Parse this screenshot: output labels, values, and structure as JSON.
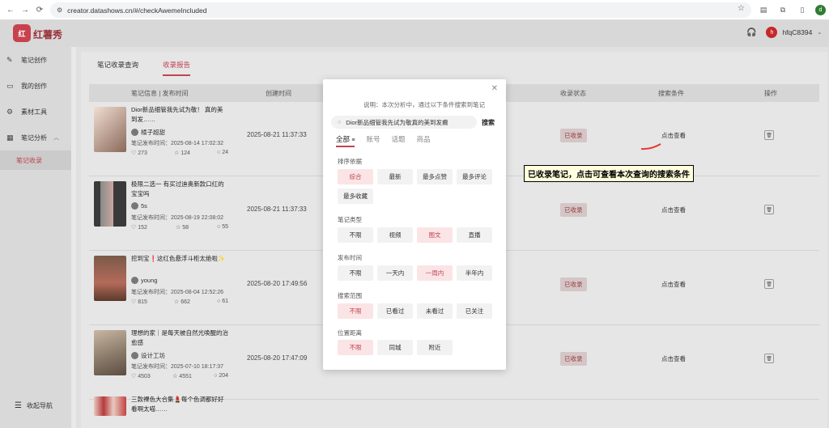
{
  "browser": {
    "url": "creator.datashows.cn/#/checkAwemeIncluded",
    "profile_initial": "d"
  },
  "app": {
    "logo_glyph": "红",
    "logo_text": "红薯秀",
    "avatar_initial": "h",
    "username": "hfqC8394"
  },
  "sidebar": {
    "items": [
      {
        "label": "笔记创作",
        "icon": "pen-icon"
      },
      {
        "label": "我的创作",
        "icon": "document-icon"
      },
      {
        "label": "素材工具",
        "icon": "tools-icon"
      },
      {
        "label": "笔记分析",
        "icon": "analysis-icon"
      }
    ],
    "sub_item": "笔记收录",
    "collapse_label": "收起导航"
  },
  "tabs": [
    "笔记收录查询",
    "收录报告"
  ],
  "table": {
    "headers": [
      "笔记信息 | 发布时间",
      "创建时间",
      "收录状态",
      "搜索条件",
      "操作"
    ],
    "rows": [
      {
        "title": "Dior新品细管我先试为敬！ 真的美到发……",
        "author": "橘子超甜",
        "pubtime": "笔记发布时间：2025-08-14 17:02:32",
        "likes": "273",
        "collects": "124",
        "comments": "24",
        "created": "2025-08-21 11:37:33",
        "status": "已收录",
        "view": "点击查看"
      },
      {
        "title": "极限二选一 有买过迪奥新款口红的宝宝吗",
        "author": "5s",
        "pubtime": "笔记发布时间：2025-08-19 22:08:02",
        "likes": "152",
        "collects": "58",
        "comments": "55",
        "created": "2025-08-21 11:37:33",
        "status": "已收录",
        "view": "点击查看"
      },
      {
        "title": "挖到宝❗这红色悬浮斗柜太绝啦✨",
        "author": "young",
        "pubtime": "笔记发布时间：2025-08-04 12:52:26",
        "likes": "815",
        "collects": "662",
        "comments": "61",
        "created": "2025-08-20 17:49:56",
        "status": "已收录",
        "view": "点击查看"
      },
      {
        "title": "理想的家｜是每天被自然光唤醒的治愈感",
        "author": "设计工坊",
        "pubtime": "笔记发布时间：2025-07-10 18:17:37",
        "likes": "4503",
        "collects": "4551",
        "comments": "204",
        "created": "2025-08-20 17:47:09",
        "status": "已收录",
        "view": "点击查看"
      },
      {
        "title": "三款裸色大合集💄每个色调都好好看啊太喵……"
      }
    ]
  },
  "modal": {
    "description": "说明：本次分析中，通过以下条件搜索到笔记",
    "search_value": "Dior新品细管我先试为敬真的美到发癫",
    "search_button": "搜索",
    "filter_tabs": [
      "全部",
      "账号",
      "话题",
      "商品"
    ],
    "sections": [
      {
        "label": "排序依据",
        "options": [
          "综合",
          "最新",
          "最多点赞",
          "最多评论",
          "最多收藏"
        ],
        "selected": "综合"
      },
      {
        "label": "笔记类型",
        "options": [
          "不限",
          "视频",
          "图文",
          "直播"
        ],
        "selected": "图文"
      },
      {
        "label": "发布时间",
        "options": [
          "不限",
          "一天内",
          "一周内",
          "半年内"
        ],
        "selected": "一周内"
      },
      {
        "label": "搜索范围",
        "options": [
          "不限",
          "已看过",
          "未看过",
          "已关注"
        ],
        "selected": "不限"
      },
      {
        "label": "位置距离",
        "options": [
          "不限",
          "同城",
          "附近"
        ],
        "selected": "不限"
      }
    ]
  },
  "annotation": "已收录笔记，点击可查看本次查询的搜索条件",
  "colors": {
    "accent": "#c2434f",
    "brand": "#c8424e",
    "annotation_bg": "#ffffdd"
  }
}
